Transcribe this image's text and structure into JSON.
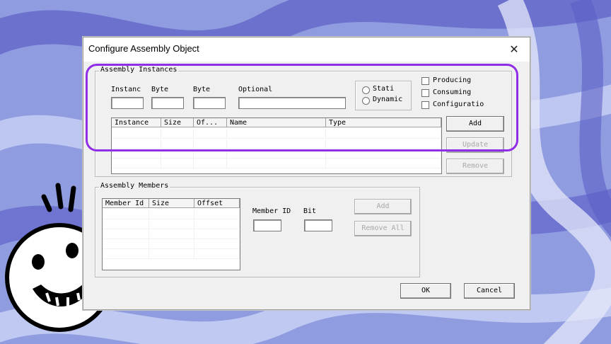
{
  "window": {
    "title": "Configure Assembly Object",
    "close_glyph": "✕"
  },
  "assembly_instances": {
    "legend": "Assembly Instances",
    "labels": {
      "instance": "Instanc",
      "byte1": "Byte",
      "byte2": "Byte",
      "optional": "Optional"
    },
    "values": {
      "instance": "",
      "byte1": "",
      "byte2": "",
      "optional": ""
    },
    "radios": [
      {
        "label": "Stati",
        "checked": false
      },
      {
        "label": "Dynamic",
        "checked": false
      }
    ],
    "checkboxes": [
      {
        "label": "Producing",
        "checked": false
      },
      {
        "label": "Consuming",
        "checked": false
      },
      {
        "label": "Configuratio",
        "checked": false
      }
    ],
    "table": {
      "headers": [
        "Instance",
        "Size",
        "Of...",
        "Name",
        "Type"
      ],
      "rows": []
    },
    "buttons": {
      "add": "Add",
      "update": "Update",
      "remove": "Remove"
    }
  },
  "assembly_members": {
    "legend": "Assembly Members",
    "table": {
      "headers": [
        "Member Id",
        "Size",
        "Offset"
      ],
      "rows": []
    },
    "labels": {
      "member_id": "Member ID",
      "bit": "Bit"
    },
    "values": {
      "member_id": "",
      "bit": ""
    },
    "buttons": {
      "add": "Add",
      "remove_all": "Remove All"
    }
  },
  "footer": {
    "ok": "OK",
    "cancel": "Cancel"
  },
  "decoration": {
    "highlight_color": "#8f2ee6",
    "face": "smiley-face-sticker"
  }
}
